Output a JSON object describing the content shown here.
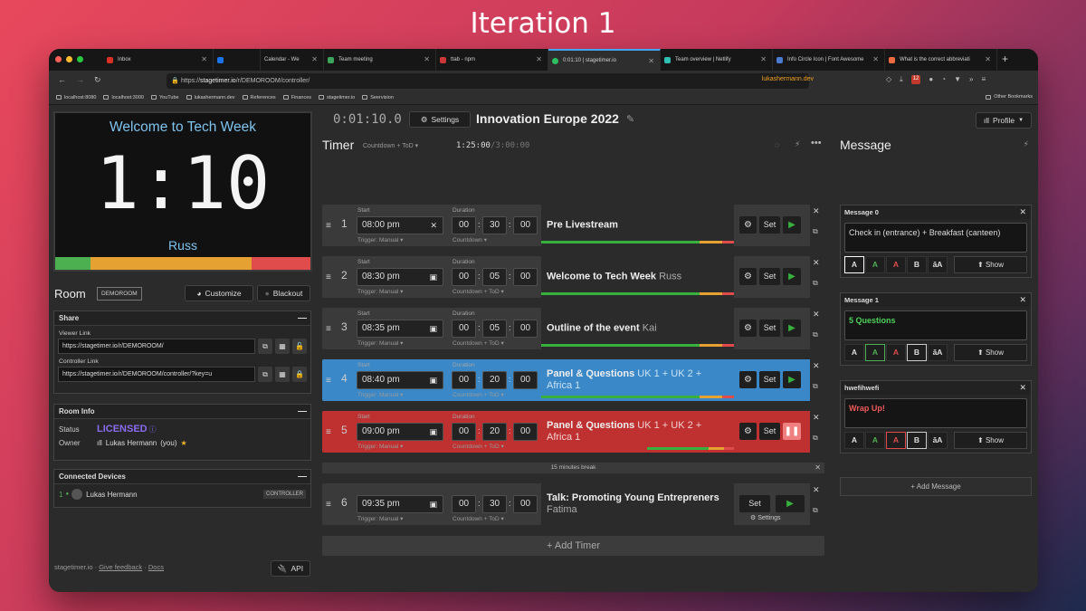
{
  "caption": "Iteration 1",
  "browser": {
    "tabs": [
      {
        "label": "Inbox",
        "fav": "#d93025"
      },
      {
        "label": "",
        "fav": "#666"
      },
      {
        "label": "Calendar - We",
        "fav": "#1a73e8"
      },
      {
        "label": "Team meeting",
        "fav": "#3ba55c"
      },
      {
        "label": "ttab - npm",
        "fav": "#cb3837"
      },
      {
        "label": "0:01:10 | stagetimer.io",
        "fav": "#2dbf62"
      },
      {
        "label": "Team overview | Netlify",
        "fav": "#2fbfb3"
      },
      {
        "label": "Info Circle Icon | Font Awesome",
        "fav": "#4a7bd0"
      },
      {
        "label": "What is the correct abbreviati",
        "fav": "#ef6a3e"
      }
    ],
    "url_prefix": "https://",
    "url_host": "stagetimer.io",
    "url_path": "/r/DEMOROOM/controller/",
    "url_right": "lukashermann.dev",
    "bookmarks": [
      "localhost:8080",
      "localhost:3000",
      "YouTube",
      "lukashermann.dev",
      "References",
      "Finances",
      "stagetimer.io",
      "Seervision"
    ],
    "other_bookmarks": "Other Bookmarks",
    "badge": "12"
  },
  "preview": {
    "title": "Welcome to Tech Week",
    "time": "1:10",
    "name": "Russ",
    "bar": [
      {
        "c": "#4caf50",
        "w": 14
      },
      {
        "c": "#e5a233",
        "w": 63
      },
      {
        "c": "#e04c4c",
        "w": 23
      }
    ]
  },
  "room": {
    "title": "Room",
    "badge": "DEMOROOM",
    "customize": "Customize",
    "blackout": "Blackout"
  },
  "share": {
    "title": "Share",
    "viewer_label": "Viewer Link",
    "viewer_url": "https://stagetimer.io/r/DEMOROOM/",
    "controller_label": "Controller Link",
    "controller_url": "https://stagetimer.io/r/DEMOROOM/controller/?key=u"
  },
  "roominfo": {
    "title": "Room Info",
    "status_k": "Status",
    "status_v": "LICENSED",
    "owner_k": "Owner",
    "owner_v": "Lukas Hermann",
    "owner_you": "(you)"
  },
  "devices": {
    "title": "Connected Devices",
    "num": "1",
    "name": "Lukas Hermann",
    "role": "CONTROLLER"
  },
  "footer": {
    "brand": "stagetimer.io",
    "sep": "·",
    "feedback": "Give feedback",
    "docs": "Docs",
    "api": "API"
  },
  "header": {
    "clock": "0:01:10.0",
    "settings": "Settings",
    "event": "Innovation Europe 2022",
    "profile": "Profile"
  },
  "timer": {
    "title": "Timer",
    "mode": "Countdown + ToD",
    "total": "1:25:00",
    "total_max": "/3:00:00"
  },
  "labels": {
    "start": "Start",
    "duration": "Duration",
    "trigger": "Trigger: Manual",
    "set": "Set",
    "settings": "Settings"
  },
  "rows": [
    {
      "num": "1",
      "start": "08:00 pm",
      "h": "00",
      "m": "30",
      "s": "00",
      "dmode": "Countdown",
      "title": "Pre Livestream",
      "speaker": "",
      "style": "",
      "ico": "✕"
    },
    {
      "num": "2",
      "start": "08:30 pm",
      "h": "00",
      "m": "05",
      "s": "00",
      "dmode": "Countdown + ToD",
      "title": "Welcome to Tech Week",
      "speaker": "Russ",
      "style": "",
      "ico": "▣"
    },
    {
      "num": "3",
      "start": "08:35 pm",
      "h": "00",
      "m": "05",
      "s": "00",
      "dmode": "Countdown + ToD",
      "title": "Outline of the event",
      "speaker": "Kai",
      "style": "",
      "ico": "▣"
    },
    {
      "num": "4",
      "start": "08:40 pm",
      "h": "00",
      "m": "20",
      "s": "00",
      "dmode": "Countdown + ToD",
      "title": "Panel & Questions",
      "speaker": "UK 1 + UK 2 + Africa 1",
      "style": "blue",
      "ico": "▣"
    },
    {
      "num": "5",
      "start": "09:00 pm",
      "h": "00",
      "m": "20",
      "s": "00",
      "dmode": "Countdown + ToD",
      "title": "Panel & Questions",
      "speaker": "UK 1 + UK 2 + Africa 1",
      "style": "red",
      "ico": "▣"
    },
    {
      "num": "6",
      "start": "09:35 pm",
      "h": "00",
      "m": "30",
      "s": "00",
      "dmode": "Countdown + ToD",
      "title": "Talk: Promoting Young Entrepreners",
      "speaker": "Fatima",
      "style": "",
      "ico": "▣"
    }
  ],
  "break_label": "15 minutes break",
  "add_timer": "Add Timer",
  "messages": {
    "title": "Message",
    "add": "Add Message",
    "show": "Show",
    "items": [
      {
        "name": "Message 0",
        "text": "Check in (entrance) + Breakfast (canteen)",
        "color": "#dddddd"
      },
      {
        "name": "Message 1",
        "text": "5 Questions",
        "color": "#4fd15a"
      },
      {
        "name": "hwefihwefi",
        "text": "Wrap Up!",
        "color": "#ef5a5a"
      }
    ]
  },
  "colors": {
    "green": "#38b03e",
    "orange": "#e5a233",
    "red": "#e04c4c",
    "blue": "#3a88c7"
  }
}
